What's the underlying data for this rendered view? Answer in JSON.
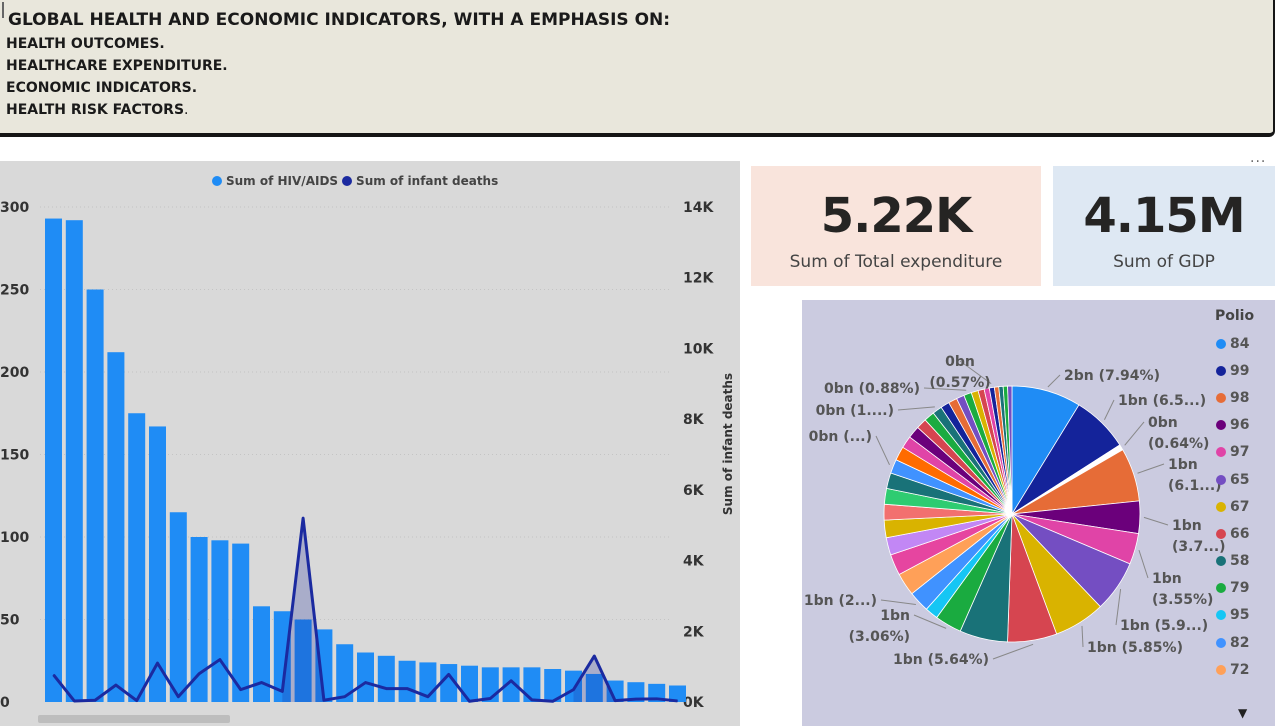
{
  "header": {
    "title": "GLOBAL HEALTH AND ECONOMIC INDICATORS, WITH A EMPHASIS ON:",
    "items": [
      "HEALTH OUTCOMES.",
      "HEALTHCARE EXPENDITURE.",
      "ECONOMIC INDICATORS.",
      "HEALTH RISK FACTORS"
    ],
    "last_suffix": "."
  },
  "more_label": "...",
  "cards": {
    "expenditure": {
      "value": "5.22K",
      "label": "Sum of Total expenditure"
    },
    "gdp": {
      "value": "4.15M",
      "label": "Sum of GDP"
    }
  },
  "chart_data": [
    {
      "type": "bar",
      "legend": [
        {
          "name": "Sum of  HIV/AIDS",
          "color": "#1f8cf5"
        },
        {
          "name": "Sum of infant deaths",
          "color": "#1b2aa0"
        }
      ],
      "y_left": {
        "ticks": [
          "300",
          "250",
          "200",
          "150",
          "100",
          "50",
          "0"
        ],
        "range": [
          0,
          300
        ]
      },
      "y_right": {
        "ticks": [
          "14K",
          "12K",
          "10K",
          "8K",
          "6K",
          "4K",
          "2K",
          "0K"
        ],
        "range": [
          0,
          14000
        ],
        "label": "Sum of infant deaths"
      },
      "highlight_index": 8,
      "series": [
        {
          "name": "Sum of  HIV/AIDS",
          "color": "#1f8cf5",
          "values": [
            293,
            292,
            250,
            212,
            175,
            167,
            115,
            100,
            98,
            96,
            58,
            55,
            50,
            44,
            35,
            30,
            28,
            25,
            24,
            23,
            22,
            21,
            21,
            21,
            20,
            19,
            17,
            13,
            12,
            11,
            10
          ]
        },
        {
          "name": "Sum of infant deaths",
          "color": "#1b2aa0",
          "values": [
            770,
            30,
            50,
            480,
            40,
            1100,
            150,
            800,
            1200,
            350,
            550,
            300,
            5200,
            50,
            150,
            550,
            380,
            380,
            150,
            780,
            20,
            100,
            600,
            60,
            20,
            350,
            1300,
            40,
            80,
            90,
            30
          ]
        }
      ]
    },
    {
      "type": "pie",
      "legend_title": "Polio",
      "legend": [
        {
          "label": "84",
          "color": "#1f8cf5"
        },
        {
          "label": "99",
          "color": "#14239a"
        },
        {
          "label": "98",
          "color": "#e66c37"
        },
        {
          "label": "96",
          "color": "#6b007b"
        },
        {
          "label": "97",
          "color": "#e044a7"
        },
        {
          "label": "65",
          "color": "#744ec2"
        },
        {
          "label": "67",
          "color": "#d9b300"
        },
        {
          "label": "66",
          "color": "#d64550"
        },
        {
          "label": "58",
          "color": "#197278"
        },
        {
          "label": "79",
          "color": "#1aab40"
        },
        {
          "label": "95",
          "color": "#15c6f4"
        },
        {
          "label": "82",
          "color": "#4092ff"
        },
        {
          "label": "72",
          "color": "#ffa058"
        }
      ],
      "slices": [
        {
          "pct": 7.94,
          "color": "#1f8cf5"
        },
        {
          "pct": 6.5,
          "color": "#14239a"
        },
        {
          "pct": 0.64,
          "color": "#ffffff"
        },
        {
          "pct": 6.1,
          "color": "#e66c37"
        },
        {
          "pct": 3.7,
          "color": "#6b007b"
        },
        {
          "pct": 3.55,
          "color": "#e044a7"
        },
        {
          "pct": 5.9,
          "color": "#744ec2"
        },
        {
          "pct": 5.85,
          "color": "#d9b300"
        },
        {
          "pct": 5.64,
          "color": "#d64550"
        },
        {
          "pct": 5.5,
          "color": "#197278"
        },
        {
          "pct": 3.06,
          "color": "#1aab40"
        },
        {
          "pct": 1.5,
          "color": "#15c6f4"
        },
        {
          "pct": 2.4,
          "color": "#4092ff"
        },
        {
          "pct": 2.6,
          "color": "#ffa058"
        },
        {
          "pct": 2.4,
          "color": "#e645a0"
        },
        {
          "pct": 2.0,
          "color": "#c287f5"
        },
        {
          "pct": 2.0,
          "color": "#d9b300"
        },
        {
          "pct": 1.8,
          "color": "#f2706f"
        },
        {
          "pct": 1.8,
          "color": "#2ecc71"
        },
        {
          "pct": 1.8,
          "color": "#197278"
        },
        {
          "pct": 1.6,
          "color": "#4092ff"
        },
        {
          "pct": 1.6,
          "color": "#ff6b00"
        },
        {
          "pct": 1.4,
          "color": "#e044a7"
        },
        {
          "pct": 1.4,
          "color": "#6b007b"
        },
        {
          "pct": 1.2,
          "color": "#d64550"
        },
        {
          "pct": 1.2,
          "color": "#1aab40"
        },
        {
          "pct": 1.1,
          "color": "#197278"
        },
        {
          "pct": 1.0,
          "color": "#14239a"
        },
        {
          "pct": 1.0,
          "color": "#e66c37"
        },
        {
          "pct": 0.9,
          "color": "#744ec2"
        },
        {
          "pct": 0.88,
          "color": "#1aab40"
        },
        {
          "pct": 0.8,
          "color": "#d9b300"
        },
        {
          "pct": 0.7,
          "color": "#d64550"
        },
        {
          "pct": 0.6,
          "color": "#e044a7"
        },
        {
          "pct": 0.57,
          "color": "#14239a"
        },
        {
          "pct": 0.5,
          "color": "#e66c37"
        },
        {
          "pct": 0.5,
          "color": "#197278"
        },
        {
          "pct": 0.5,
          "color": "#1aab40"
        },
        {
          "pct": 0.5,
          "color": "#744ec2"
        }
      ],
      "labels": [
        {
          "lines": [
            "2bn (7.94%)"
          ]
        },
        {
          "lines": [
            "1bn (6.5...)"
          ]
        },
        {
          "lines": [
            "0bn",
            "(0.64%)"
          ]
        },
        {
          "lines": [
            "1bn",
            "(6.1...)"
          ]
        },
        {
          "lines": [
            "1bn",
            "(3.7...)"
          ]
        },
        {
          "lines": [
            "1bn",
            "(3.55%)"
          ]
        },
        {
          "lines": [
            "1bn (5.9...)"
          ]
        },
        {
          "lines": [
            "1bn (5.85%)"
          ]
        },
        {
          "lines": [
            "1bn (5.64%)"
          ]
        },
        {
          "lines": [
            "1bn",
            "(3.06%)"
          ]
        },
        {
          "lines": [
            "1bn (2...)"
          ]
        },
        {
          "lines": [
            "0bn (...)"
          ]
        },
        {
          "lines": [
            "0bn (1....)"
          ]
        },
        {
          "lines": [
            "0bn (0.88%)"
          ]
        },
        {
          "lines": [
            "0bn",
            "(0.57%)"
          ]
        }
      ]
    }
  ]
}
